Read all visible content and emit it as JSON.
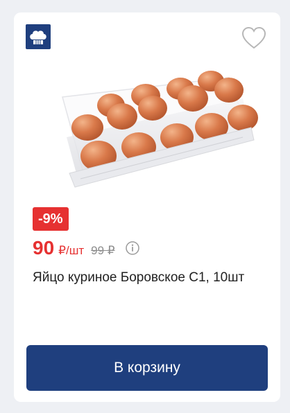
{
  "card": {
    "brand_icon": "chef-hat-icon",
    "favorite_icon": "heart-outline-icon",
    "image_alt": "eggs-in-plastic-tray",
    "discount_badge": "-9%",
    "price": {
      "current": "90",
      "unit": "₽/шт",
      "old": "99 ₽",
      "info_icon": "info-icon"
    },
    "title": "Яйцо куриное Боровское С1, 10шт",
    "button_label": "В корзину"
  },
  "colors": {
    "brand_blue": "#1f3f7e",
    "discount_red": "#e63131",
    "old_price_gray": "#8d8d8d"
  }
}
